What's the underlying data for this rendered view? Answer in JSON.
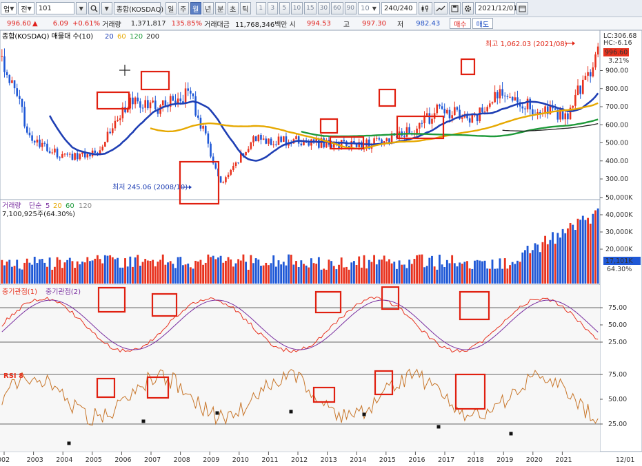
{
  "toolbar": {
    "market_btn": "업",
    "period_btn": "전",
    "code_value": "101",
    "index_name": "종합(KOSDAQ)",
    "period_tabs": [
      "일",
      "주",
      "월",
      "년",
      "분",
      "초",
      "틱"
    ],
    "active_period": "월",
    "intervals": [
      "1",
      "3",
      "5",
      "10",
      "15",
      "30",
      "60",
      "90"
    ],
    "interval_value": "10",
    "count_value": "240/240",
    "date_value": "2021/12/01"
  },
  "quote": {
    "price": "996.60",
    "change": "6.09",
    "change_pct": "+0.61%",
    "volume_label": "거래량",
    "volume": "1,371,817",
    "volume_pct": "135.85%",
    "amount_label": "거래대금",
    "amount": "11,768,346백만",
    "open_label": "시",
    "open": "994.53",
    "high_label": "고",
    "high": "997.30",
    "low_label": "저",
    "low": "982.43",
    "buy_label": "매수",
    "sell_label": "매도"
  },
  "price_panel": {
    "legend_title": "종합(KOSDAQ) 매물대 수(10)",
    "legend_periods": [
      "20",
      "60",
      "120",
      "200"
    ],
    "legend_colors": [
      "#1f3fb4",
      "#e6a800",
      "#1e9a3a",
      "#222222"
    ],
    "high_note": "최고 1,062.03 (2021/08)",
    "low_note": "최저 245.06 (2008/10)",
    "lc": "LC:306.68",
    "hc": "HC:-6.16",
    "current_price": "996.60",
    "current_pct": "3.21%",
    "y_ticks": [
      "900.00",
      "800.00",
      "700.00",
      "600.00",
      "500.00",
      "400.00",
      "300.00"
    ]
  },
  "volume_panel": {
    "legend_title": "거래량",
    "legend_ma_label": "단순",
    "legend_periods": [
      "5",
      "20",
      "60",
      "120"
    ],
    "legend_colors": [
      "#7a2fa0",
      "#e6a800",
      "#1e9a3a",
      "#888888"
    ],
    "value_text": "7,100,925주(64.30%)",
    "current": "17,101K",
    "current_pct": "64.30%",
    "y_ticks": [
      "50,000K",
      "40,000K",
      "30,000K",
      "20,000K"
    ]
  },
  "stoch_panel": {
    "legend_1": "중기관점(1)",
    "legend_2": "중기관점(2)",
    "y_ticks": [
      "75.00",
      "50.00",
      "25.00"
    ]
  },
  "rsi_panel": {
    "legend": "RSI 8",
    "y_ticks": [
      "75.00",
      "50.00",
      "25.00"
    ]
  },
  "x_axis": {
    "labels": [
      "002",
      "2003",
      "2004",
      "2005",
      "2006",
      "2007",
      "2008",
      "2009",
      "2010",
      "2011",
      "2012",
      "2013",
      "2014",
      "2015",
      "2016",
      "2017",
      "2018",
      "2019",
      "2020",
      "2021"
    ],
    "right_label": "12/01"
  },
  "colors": {
    "up": "#e8321e",
    "down": "#1f58d6",
    "ma20": "#1f3fb4",
    "ma60": "#e6a800",
    "ma120": "#1e9a3a",
    "ma200": "#222222",
    "highlight": "#e02010",
    "volume_profile": "#f6dcc0"
  },
  "chart_data": {
    "type": "candlestick",
    "title": "종합(KOSDAQ)",
    "x_range": [
      "2002",
      "2021/12"
    ],
    "y_range_price": [
      245.06,
      1062.03
    ],
    "price_path_year_close": [
      {
        "x": "2002",
        "y": 960
      },
      {
        "x": "2003",
        "y": 500
      },
      {
        "x": "2004",
        "y": 420
      },
      {
        "x": "2005",
        "y": 450
      },
      {
        "x": "2006",
        "y": 720
      },
      {
        "x": "2007",
        "y": 700
      },
      {
        "x": "2008",
        "y": 780
      },
      {
        "x": "2009",
        "y": 260
      },
      {
        "x": "2010",
        "y": 520
      },
      {
        "x": "2011",
        "y": 510
      },
      {
        "x": "2012",
        "y": 500
      },
      {
        "x": "2013",
        "y": 490
      },
      {
        "x": "2014",
        "y": 500
      },
      {
        "x": "2015",
        "y": 560
      },
      {
        "x": "2016",
        "y": 690
      },
      {
        "x": "2017",
        "y": 620
      },
      {
        "x": "2018",
        "y": 800
      },
      {
        "x": "2019",
        "y": 680
      },
      {
        "x": "2020",
        "y": 650
      },
      {
        "x": "2021",
        "y": 996.6
      }
    ],
    "stochastic_levels": [
      75,
      50,
      25
    ],
    "rsi_levels": [
      75,
      50,
      25
    ]
  }
}
